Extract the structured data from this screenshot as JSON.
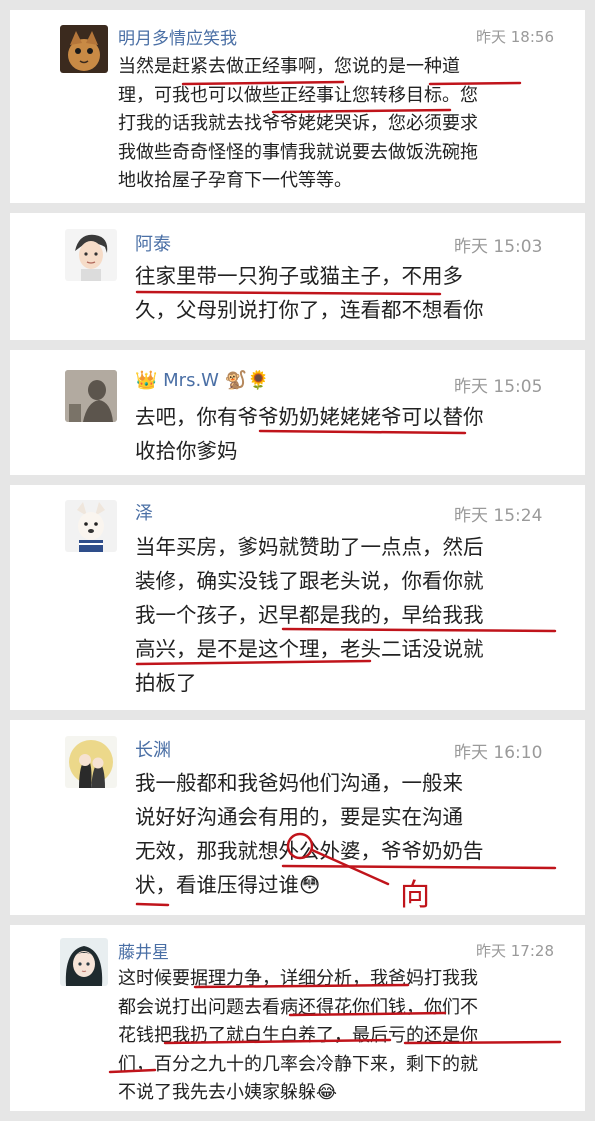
{
  "comments": [
    {
      "name": "明月多情应笑我",
      "time": "昨天 18:56",
      "text": "当然是赶紧去做正经事啊，您说的是一种道\n理，可我也可以做些正经事让您转移目标。您\n打我的话我就去找爷爷姥姥哭诉，您必须要求\n我做些奇奇怪怪的事情我就说要去做饭洗碗拖\n地收拾屋子孕育下一代等等。"
    },
    {
      "name": "阿泰",
      "time": "昨天 15:03",
      "text": "往家里带一只狗子或猫主子，不用多\n久，父母别说打你了，连看都不想看你"
    },
    {
      "name": "Mrs.W",
      "name_badge": "👑",
      "name_emojis": "🐒🌻",
      "time": "昨天 15:05",
      "text": "去吧，你有爷爷奶奶姥姥姥爷可以替你\n收拾你爹妈"
    },
    {
      "name": "泽",
      "time": "昨天 15:24",
      "text": "当年买房，爹妈就赞助了一点点，然后\n装修，确实没钱了跟老头说，你看你就\n我一个孩子，迟早都是我的，早给我我\n高兴，是不是这个理，老头二话没说就\n拍板了"
    },
    {
      "name": "长渊",
      "time": "昨天 16:10",
      "text": "我一般都和我爸妈他们沟通，一般来\n说好好沟通会有用的，要是实在沟通\n无效，那我就想外公外婆，爷爷奶奶告\n状，看谁压得过谁😳",
      "annotation": "向"
    },
    {
      "name": "藤井星",
      "time": "昨天 17:28",
      "text": "这时候要据理力争，详细分析，我爸妈打我我\n都会说打出问题去看病还得花你们钱，你们不\n花钱把我扔了就白生白养了，最后亏的还是你\n们，百分之九十的几率会冷静下来，剩下的就\n不说了我先去小姨家躲躲😂"
    }
  ],
  "colors": {
    "name": "#4a6fa5",
    "time": "#9a9a9a",
    "text": "#222222",
    "underline": "#c0141b",
    "background": "#e6e6e6"
  },
  "icons": [
    "avatar-cat",
    "avatar-anime-boy",
    "avatar-shadow-photo",
    "avatar-dog",
    "avatar-couple-moon",
    "avatar-anime-girl"
  ]
}
